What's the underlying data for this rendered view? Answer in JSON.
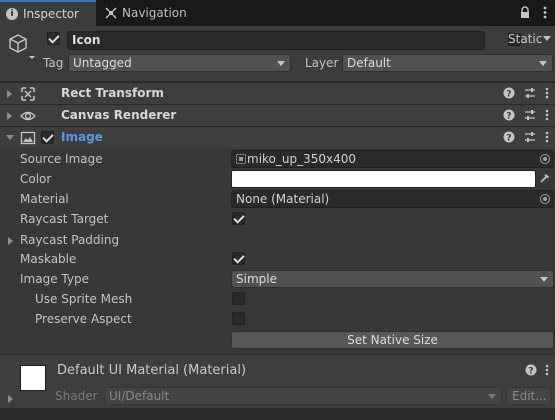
{
  "tabs": [
    {
      "label": "Inspector",
      "icon": "info-icon",
      "active": true
    },
    {
      "label": "Navigation",
      "icon": "navigation-icon",
      "active": false
    }
  ],
  "header": {
    "name": "Icon",
    "active": true,
    "static_label": "Static",
    "static_checked": false,
    "tag_label": "Tag",
    "tag_value": "Untagged",
    "layer_label": "Layer",
    "layer_value": "Default"
  },
  "components": [
    {
      "title": "Rect Transform",
      "icon": "rect-transform-icon",
      "expanded": false
    },
    {
      "title": "Canvas Renderer",
      "icon": "eye-icon",
      "expanded": false
    },
    {
      "title": "Image",
      "icon": "image-icon",
      "expanded": true,
      "enabled": true
    }
  ],
  "image_props": {
    "source_image_label": "Source Image",
    "source_image_value": "miko_up_350x400",
    "color_label": "Color",
    "color_value": "#ffffff",
    "material_label": "Material",
    "material_value": "None (Material)",
    "raycast_target_label": "Raycast Target",
    "raycast_target": true,
    "raycast_padding_label": "Raycast Padding",
    "maskable_label": "Maskable",
    "maskable": true,
    "image_type_label": "Image Type",
    "image_type_value": "Simple",
    "use_sprite_mesh_label": "Use Sprite Mesh",
    "use_sprite_mesh": false,
    "preserve_aspect_label": "Preserve Aspect",
    "preserve_aspect": false,
    "set_native_size_label": "Set Native Size"
  },
  "material_section": {
    "title": "Default UI Material (Material)",
    "shader_label": "Shader",
    "shader_value": "UI/Default",
    "edit_label": "Edit..."
  },
  "colors": {
    "accent_blue": "#3a79bb",
    "image_title_blue": "#5a9ae6",
    "panel_bg": "#383838"
  }
}
